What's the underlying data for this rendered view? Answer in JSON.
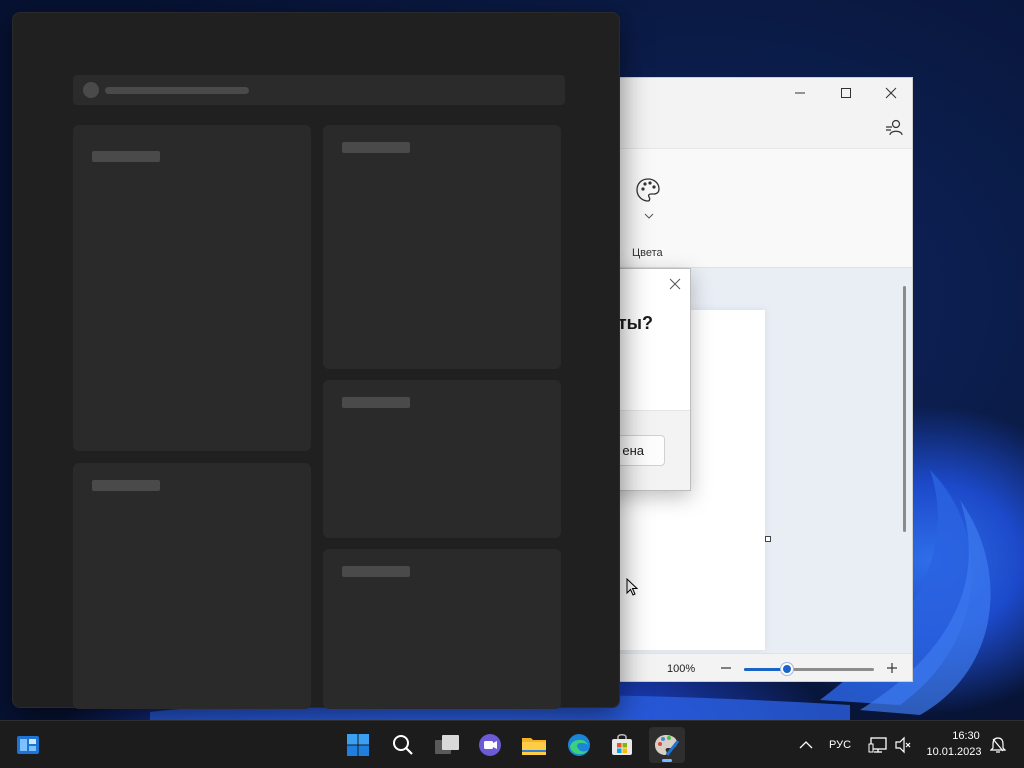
{
  "paint": {
    "ribbon_colors_label": "Цвета",
    "zoom_value": "100%",
    "zoom_minus_symbol": "—",
    "zoom_plus_symbol": "+",
    "zoom_level_fraction": 0.33
  },
  "dialog": {
    "title_fragment": "ты?",
    "button_fragment": "ена"
  },
  "widgets": {
    "state": "loading"
  },
  "taskbar": {
    "language": "РУС",
    "time": "16:30",
    "date": "10.01.2023",
    "icons": [
      "widgets-icon",
      "start-icon",
      "search-icon",
      "task-view-icon",
      "chat-icon",
      "file-explorer-icon",
      "edge-icon",
      "store-icon",
      "paint-icon"
    ],
    "tray_icons": [
      "show-hidden-icons-chevron",
      "network-icon",
      "volume-muted-icon",
      "notifications-icon"
    ]
  },
  "colors": {
    "accent": "#1a64c8",
    "widget_panel": "#202020",
    "taskbar": "#1c1c1c"
  }
}
